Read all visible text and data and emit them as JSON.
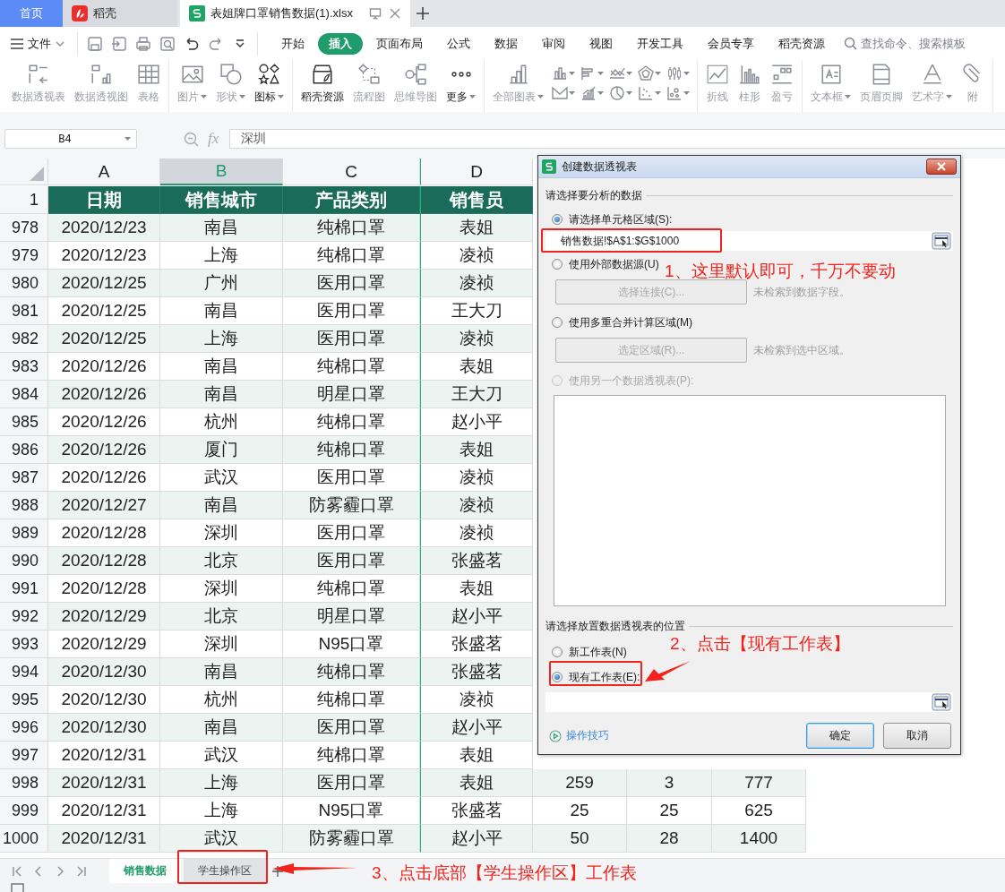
{
  "tabs": [
    {
      "label": "首页",
      "kind": "home",
      "selected": false
    },
    {
      "label": "稻壳",
      "kind": "app",
      "selected": false
    },
    {
      "label": "表姐牌口罩销售数据(1).xlsx",
      "kind": "file",
      "selected": true
    }
  ],
  "menu": {
    "file_label": "文件",
    "search_placeholder": "查找命令、搜索模板",
    "ribbon_tabs": [
      {
        "label": "开始",
        "selected": false
      },
      {
        "label": "插入",
        "selected": true
      },
      {
        "label": "页面布局",
        "selected": false
      },
      {
        "label": "公式",
        "selected": false
      },
      {
        "label": "数据",
        "selected": false
      },
      {
        "label": "审阅",
        "selected": false
      },
      {
        "label": "视图",
        "selected": false
      },
      {
        "label": "开发工具",
        "selected": false
      },
      {
        "label": "会员专享",
        "selected": false
      },
      {
        "label": "稻壳资源",
        "selected": false
      }
    ]
  },
  "ribbon": {
    "groups": [
      {
        "items": [
          {
            "label": "数据透视表",
            "disabled": true,
            "dropdown": false
          },
          {
            "label": "数据透视图",
            "disabled": true,
            "dropdown": false
          },
          {
            "label": "表格",
            "disabled": true,
            "dropdown": false
          }
        ]
      },
      {
        "items": [
          {
            "label": "图片",
            "disabled": true,
            "dropdown": true
          },
          {
            "label": "形状",
            "disabled": true,
            "dropdown": true
          },
          {
            "label": "图标",
            "disabled": false,
            "dropdown": true
          }
        ]
      },
      {
        "items": [
          {
            "label": "稻壳资源",
            "disabled": false,
            "dropdown": false
          },
          {
            "label": "流程图",
            "disabled": true,
            "dropdown": false
          },
          {
            "label": "思维导图",
            "disabled": true,
            "dropdown": false
          },
          {
            "label": "更多",
            "disabled": false,
            "dropdown": true
          }
        ]
      },
      {
        "chart_gallery": true,
        "items": [
          {
            "label": "全部图表",
            "disabled": true,
            "dropdown": true
          }
        ]
      },
      {
        "items": [
          {
            "label": "折线",
            "disabled": true,
            "dropdown": false
          },
          {
            "label": "柱形",
            "disabled": true,
            "dropdown": false
          },
          {
            "label": "盈亏",
            "disabled": true,
            "dropdown": false
          }
        ]
      },
      {
        "items": [
          {
            "label": "文本框",
            "disabled": true,
            "dropdown": true
          },
          {
            "label": "页眉页脚",
            "disabled": true,
            "dropdown": false
          },
          {
            "label": "艺术字",
            "disabled": true,
            "dropdown": true
          },
          {
            "label": "附",
            "disabled": true,
            "dropdown": false
          }
        ]
      }
    ]
  },
  "formula": {
    "name_box": "B4",
    "fx_label": "fx",
    "content": "深圳"
  },
  "grid": {
    "columns": [
      {
        "letter": "A",
        "selected": false
      },
      {
        "letter": "B",
        "selected": true
      },
      {
        "letter": "C",
        "selected": false
      },
      {
        "letter": "D",
        "selected": false
      }
    ],
    "header_row": {
      "number": "1",
      "cells": [
        "日期",
        "销售城市",
        "产品类别",
        "销售员"
      ]
    },
    "rows": [
      {
        "number": "978",
        "cells": [
          "2020/12/23",
          "南昌",
          "纯棉口罩",
          "表姐"
        ]
      },
      {
        "number": "979",
        "cells": [
          "2020/12/23",
          "上海",
          "纯棉口罩",
          "凌祯"
        ]
      },
      {
        "number": "980",
        "cells": [
          "2020/12/25",
          "广州",
          "医用口罩",
          "凌祯"
        ]
      },
      {
        "number": "981",
        "cells": [
          "2020/12/25",
          "南昌",
          "医用口罩",
          "王大刀"
        ]
      },
      {
        "number": "982",
        "cells": [
          "2020/12/25",
          "上海",
          "医用口罩",
          "凌祯"
        ]
      },
      {
        "number": "983",
        "cells": [
          "2020/12/26",
          "南昌",
          "纯棉口罩",
          "表姐"
        ]
      },
      {
        "number": "984",
        "cells": [
          "2020/12/26",
          "南昌",
          "明星口罩",
          "王大刀"
        ]
      },
      {
        "number": "985",
        "cells": [
          "2020/12/26",
          "杭州",
          "纯棉口罩",
          "赵小平"
        ]
      },
      {
        "number": "986",
        "cells": [
          "2020/12/26",
          "厦门",
          "纯棉口罩",
          "表姐"
        ]
      },
      {
        "number": "987",
        "cells": [
          "2020/12/26",
          "武汉",
          "医用口罩",
          "凌祯"
        ]
      },
      {
        "number": "988",
        "cells": [
          "2020/12/27",
          "南昌",
          "防雾霾口罩",
          "凌祯"
        ]
      },
      {
        "number": "989",
        "cells": [
          "2020/12/28",
          "深圳",
          "医用口罩",
          "凌祯"
        ]
      },
      {
        "number": "990",
        "cells": [
          "2020/12/28",
          "北京",
          "医用口罩",
          "张盛茗"
        ]
      },
      {
        "number": "991",
        "cells": [
          "2020/12/28",
          "深圳",
          "纯棉口罩",
          "表姐"
        ]
      },
      {
        "number": "992",
        "cells": [
          "2020/12/29",
          "北京",
          "明星口罩",
          "赵小平"
        ]
      },
      {
        "number": "993",
        "cells": [
          "2020/12/29",
          "深圳",
          "N95口罩",
          "张盛茗"
        ]
      },
      {
        "number": "994",
        "cells": [
          "2020/12/30",
          "南昌",
          "纯棉口罩",
          "张盛茗"
        ]
      },
      {
        "number": "995",
        "cells": [
          "2020/12/30",
          "杭州",
          "纯棉口罩",
          "凌祯"
        ]
      },
      {
        "number": "996",
        "cells": [
          "2020/12/30",
          "南昌",
          "医用口罩",
          "赵小平"
        ]
      },
      {
        "number": "997",
        "cells": [
          "2020/12/31",
          "武汉",
          "纯棉口罩",
          "表姐"
        ]
      },
      {
        "number": "998",
        "cells": [
          "2020/12/31",
          "上海",
          "医用口罩",
          "表姐",
          "259",
          "3",
          "777"
        ]
      },
      {
        "number": "999",
        "cells": [
          "2020/12/31",
          "上海",
          "N95口罩",
          "张盛茗",
          "25",
          "25",
          "625"
        ]
      },
      {
        "number": "1000",
        "cells": [
          "2020/12/31",
          "武汉",
          "防雾霾口罩",
          "赵小平",
          "50",
          "28",
          "1400"
        ]
      }
    ]
  },
  "sheet_tabs": [
    {
      "label": "销售数据",
      "selected": true
    },
    {
      "label": "学生操作区",
      "selected": false
    }
  ],
  "dialog": {
    "title": "创建数据透视表",
    "source_heading": "请选择要分析的数据",
    "source_options": [
      {
        "kind": "range",
        "label": "请选择单元格区域(S):",
        "selected": true,
        "disabled": false,
        "value": "销售数据!$A$1:$G$1000"
      },
      {
        "kind": "action",
        "label": "使用外部数据源(U)",
        "selected": false,
        "disabled": false,
        "button": {
          "label": "选择连接(C)...",
          "disabled": true
        },
        "hint": "未检索到数据字段。"
      },
      {
        "kind": "action",
        "label": "使用多重合并计算区域(M)",
        "selected": false,
        "disabled": false,
        "button": {
          "label": "选定区域(R)...",
          "disabled": true
        },
        "hint": "未检索到选中区域。"
      },
      {
        "kind": "list",
        "label": "使用另一个数据透视表(P):",
        "selected": false,
        "disabled": true
      }
    ],
    "target_heading": "请选择放置数据透视表的位置",
    "target_options": [
      {
        "kind": "plain",
        "label": "新工作表(N)",
        "selected": false,
        "disabled": false
      },
      {
        "kind": "range",
        "label": "现有工作表(E):",
        "selected": true,
        "disabled": false
      }
    ],
    "tips_link": "操作技巧",
    "buttons": [
      {
        "label": "确定",
        "default": true
      },
      {
        "label": "取消",
        "default": false
      }
    ]
  },
  "annotations": [
    {
      "text": "1、这里默认即可，千万不要动"
    },
    {
      "text": "2、点击【现有工作表】"
    },
    {
      "text": "3、点击底部【学生操作区】工作表"
    }
  ]
}
